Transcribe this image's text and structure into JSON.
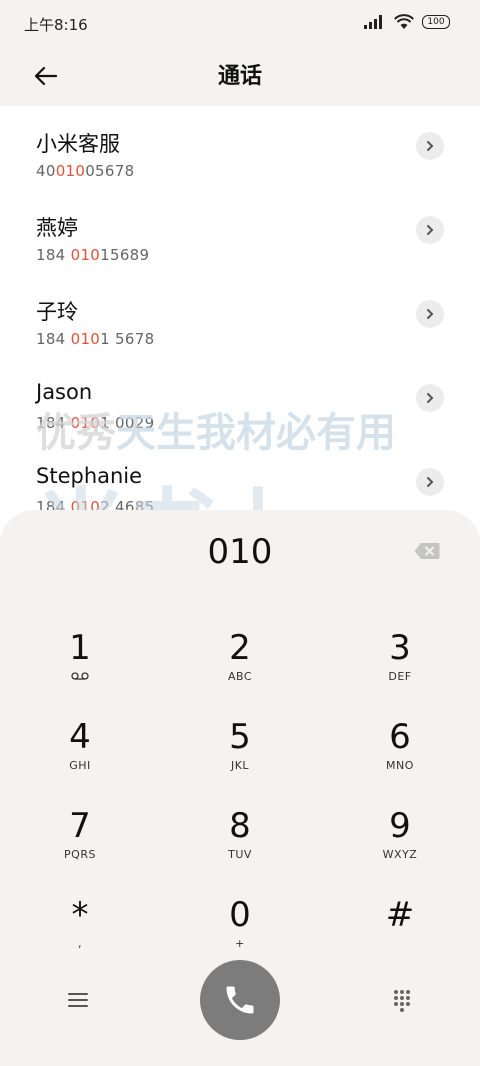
{
  "status_bar": {
    "time": "上午8:16",
    "battery": "100"
  },
  "header": {
    "title": "通话"
  },
  "contacts": [
    {
      "name": "小米客服",
      "num_pre": "40",
      "num_hl": "010",
      "num_post": "05678"
    },
    {
      "name": "燕婷",
      "num_pre": "184 ",
      "num_hl": "010",
      "num_post": "15689"
    },
    {
      "name": "子玲",
      "num_pre": "184 ",
      "num_hl": "010",
      "num_post": "1 5678"
    },
    {
      "name": "Jason",
      "num_pre": "184 ",
      "num_hl": "010",
      "num_post": "1 0029"
    },
    {
      "name": "Stephanie",
      "num_pre": "184 ",
      "num_hl": "010",
      "num_post": "2 4685"
    }
  ],
  "watermark": {
    "line1_a": "优秀",
    "line1_b": "天生我材必有用",
    "line2": "米书上"
  },
  "dialpad": {
    "dialed": "010",
    "keys": [
      {
        "digit": "1",
        "sub": ""
      },
      {
        "digit": "2",
        "sub": "ABC"
      },
      {
        "digit": "3",
        "sub": "DEF"
      },
      {
        "digit": "4",
        "sub": "GHI"
      },
      {
        "digit": "5",
        "sub": "JKL"
      },
      {
        "digit": "6",
        "sub": "MNO"
      },
      {
        "digit": "7",
        "sub": "PQRS"
      },
      {
        "digit": "8",
        "sub": "TUV"
      },
      {
        "digit": "9",
        "sub": "WXYZ"
      },
      {
        "digit": "*",
        "sub": ","
      },
      {
        "digit": "0",
        "sub": "+"
      },
      {
        "digit": "#",
        "sub": ""
      }
    ]
  },
  "colors": {
    "highlight": "#e25239",
    "call_button": "#7c7c7c",
    "panel": "#f4f3f1"
  }
}
